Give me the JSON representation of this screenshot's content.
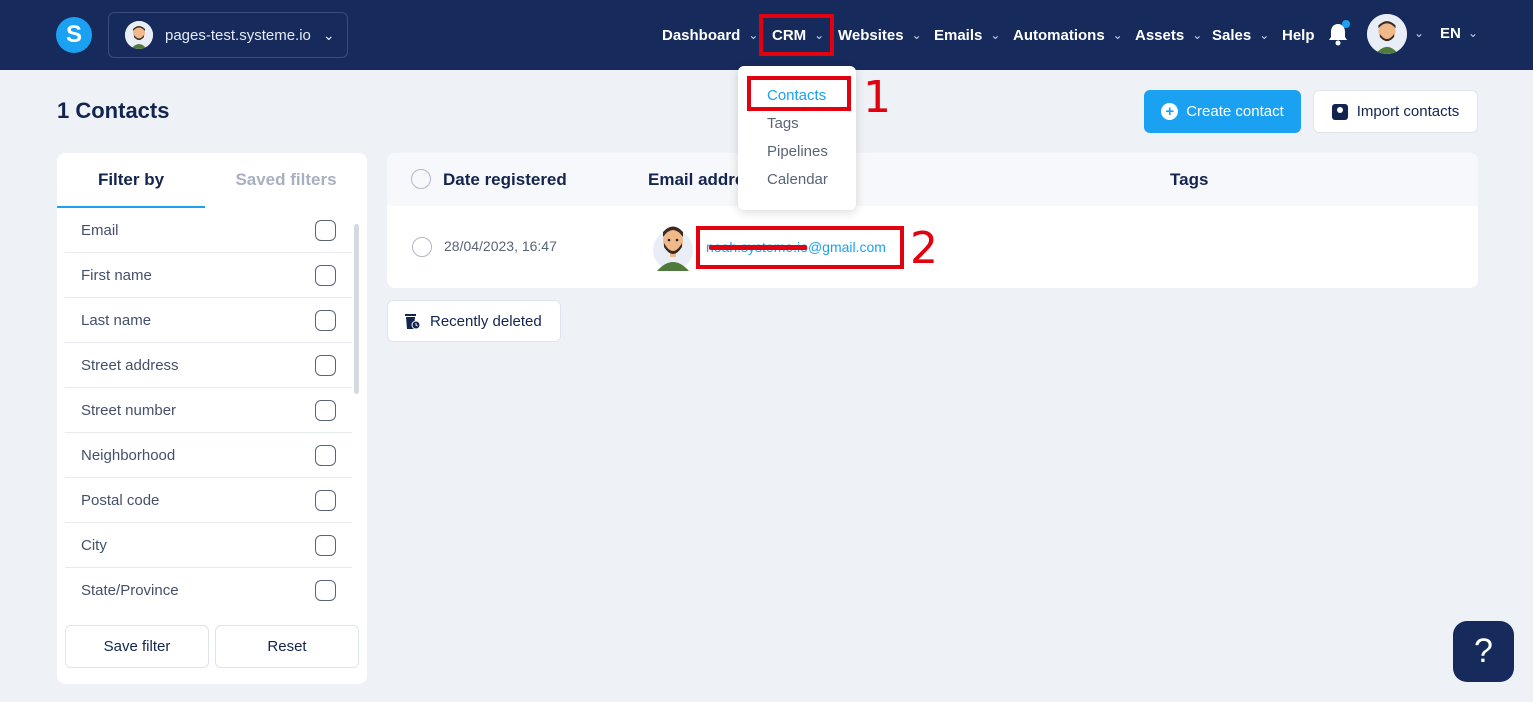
{
  "header": {
    "logo_letter": "S",
    "site_name": "pages-test.systeme.io",
    "nav": [
      {
        "label": "Dashboard"
      },
      {
        "label": "CRM"
      },
      {
        "label": "Websites"
      },
      {
        "label": "Emails"
      },
      {
        "label": "Automations"
      },
      {
        "label": "Assets"
      },
      {
        "label": "Sales"
      },
      {
        "label": "Help"
      }
    ],
    "language": "EN"
  },
  "crm_menu": {
    "items": [
      "Contacts",
      "Tags",
      "Pipelines",
      "Calendar"
    ],
    "active": "Contacts"
  },
  "page": {
    "title": "1 Contacts",
    "create_button": "Create contact",
    "import_button": "Import contacts"
  },
  "filters": {
    "tabs": [
      "Filter by",
      "Saved filters"
    ],
    "fields": [
      "Email",
      "First name",
      "Last name",
      "Street address",
      "Street number",
      "Neighborhood",
      "Postal code",
      "City",
      "State/Province"
    ],
    "save_button": "Save filter",
    "reset_button": "Reset"
  },
  "table": {
    "columns": [
      "Date registered",
      "Email addre",
      "Tags"
    ],
    "rows": [
      {
        "date": "28/04/2023, 16:47",
        "email": "noah.systeme.io@gmail.com"
      }
    ]
  },
  "recently_deleted": "Recently deleted",
  "annotations": [
    "1",
    "2"
  ],
  "help_symbol": "?",
  "colors": {
    "nav_bg": "#162a5c",
    "accent": "#1ba1f1",
    "annotation": "#e3000f",
    "page_bg": "#eef2f7"
  }
}
